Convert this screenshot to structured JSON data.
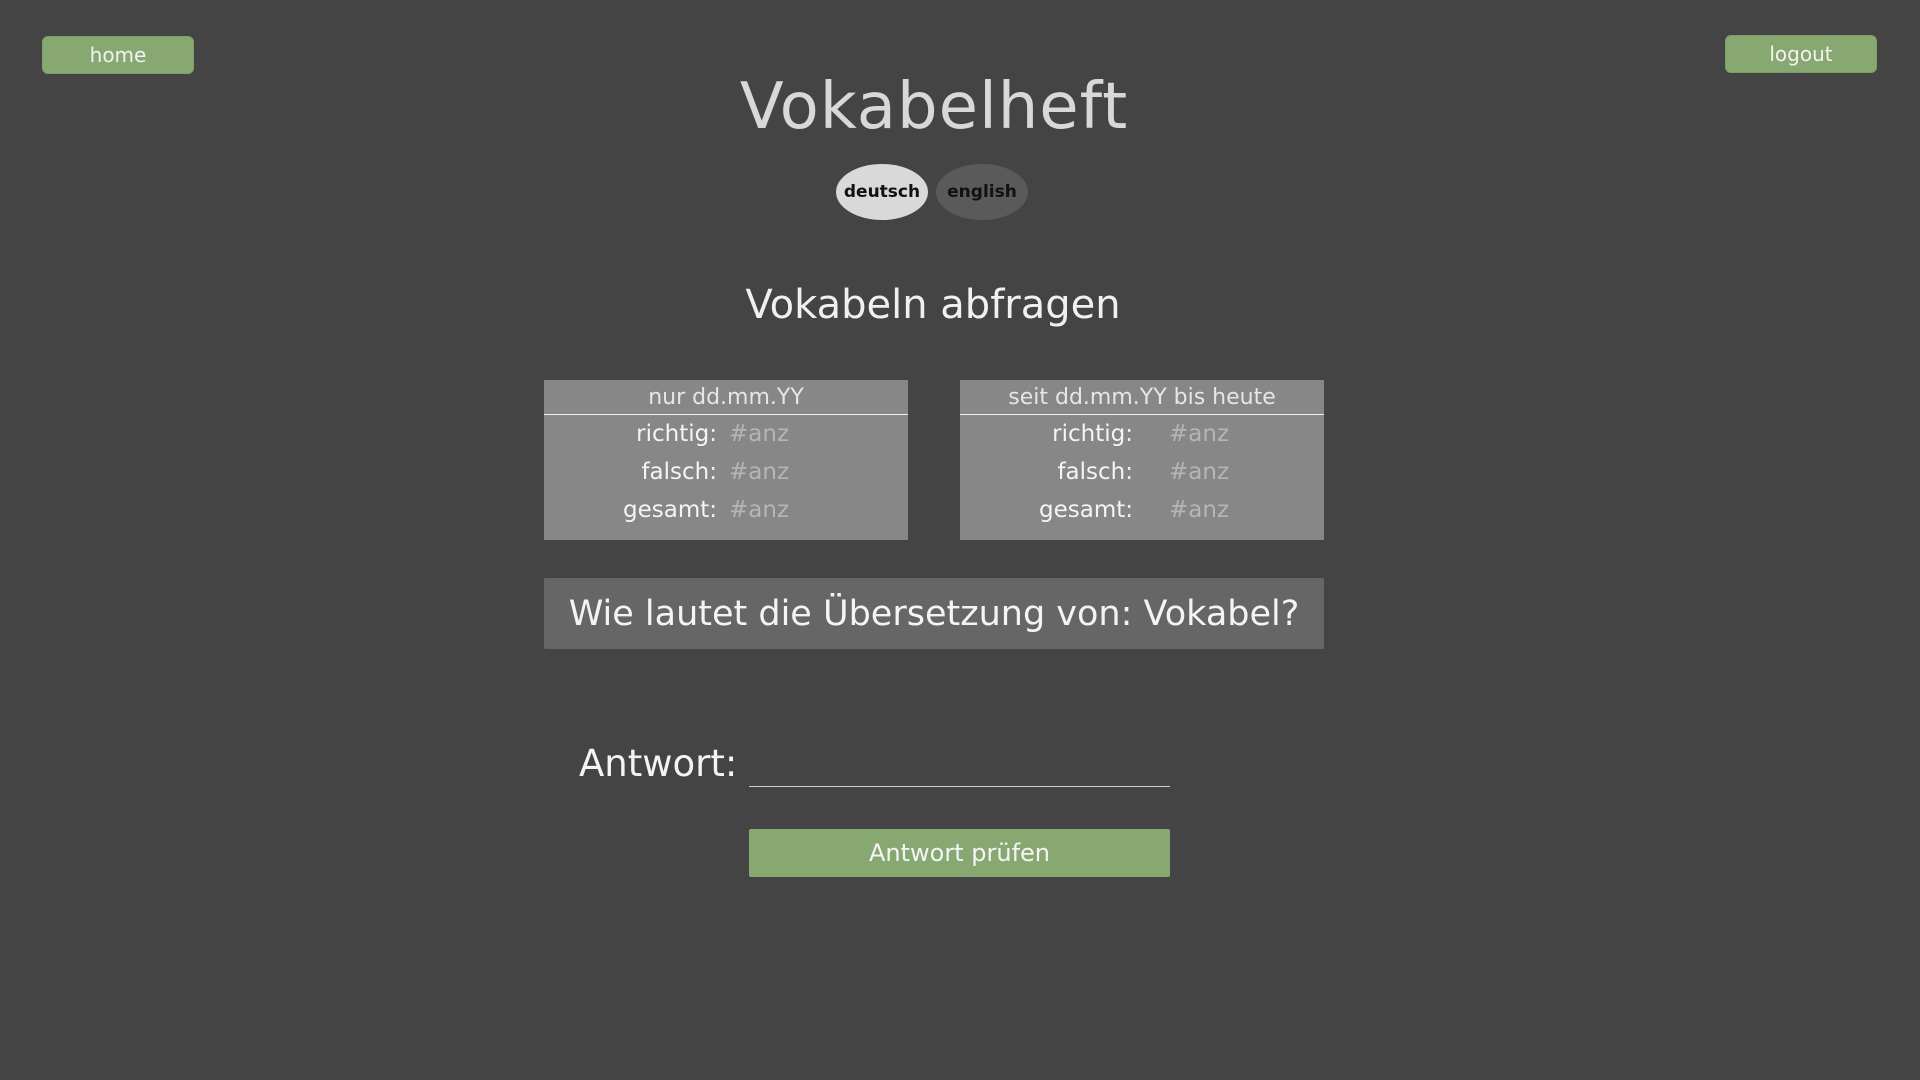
{
  "nav": {
    "home_label": "home",
    "logout_label": "logout"
  },
  "header": {
    "title": "Vokabelheft",
    "languages": [
      {
        "label": "deutsch",
        "active": true
      },
      {
        "label": "english",
        "active": false
      }
    ]
  },
  "quiz": {
    "section_title": "Vokabeln abfragen",
    "stats_today": {
      "heading": "nur dd.mm.YY",
      "rows": [
        {
          "label": "richtig:",
          "value": "#anz"
        },
        {
          "label": "falsch:",
          "value": "#anz"
        },
        {
          "label": "gesamt:",
          "value": "#anz"
        }
      ]
    },
    "stats_since": {
      "heading": "seit dd.mm.YY bis heute",
      "rows": [
        {
          "label": "richtig:",
          "value": "#anz"
        },
        {
          "label": "falsch:",
          "value": "#anz"
        },
        {
          "label": "gesamt:",
          "value": "#anz"
        }
      ]
    },
    "question": "Wie lautet die Übersetzung von: Vokabel?",
    "answer_label": "Antwort:",
    "answer_value": "",
    "answer_placeholder": "",
    "check_button_label": "Antwort prüfen"
  },
  "colors": {
    "background": "#444444",
    "accent_green": "#88a872",
    "stats_bg": "#878787",
    "question_bg": "#666666"
  }
}
